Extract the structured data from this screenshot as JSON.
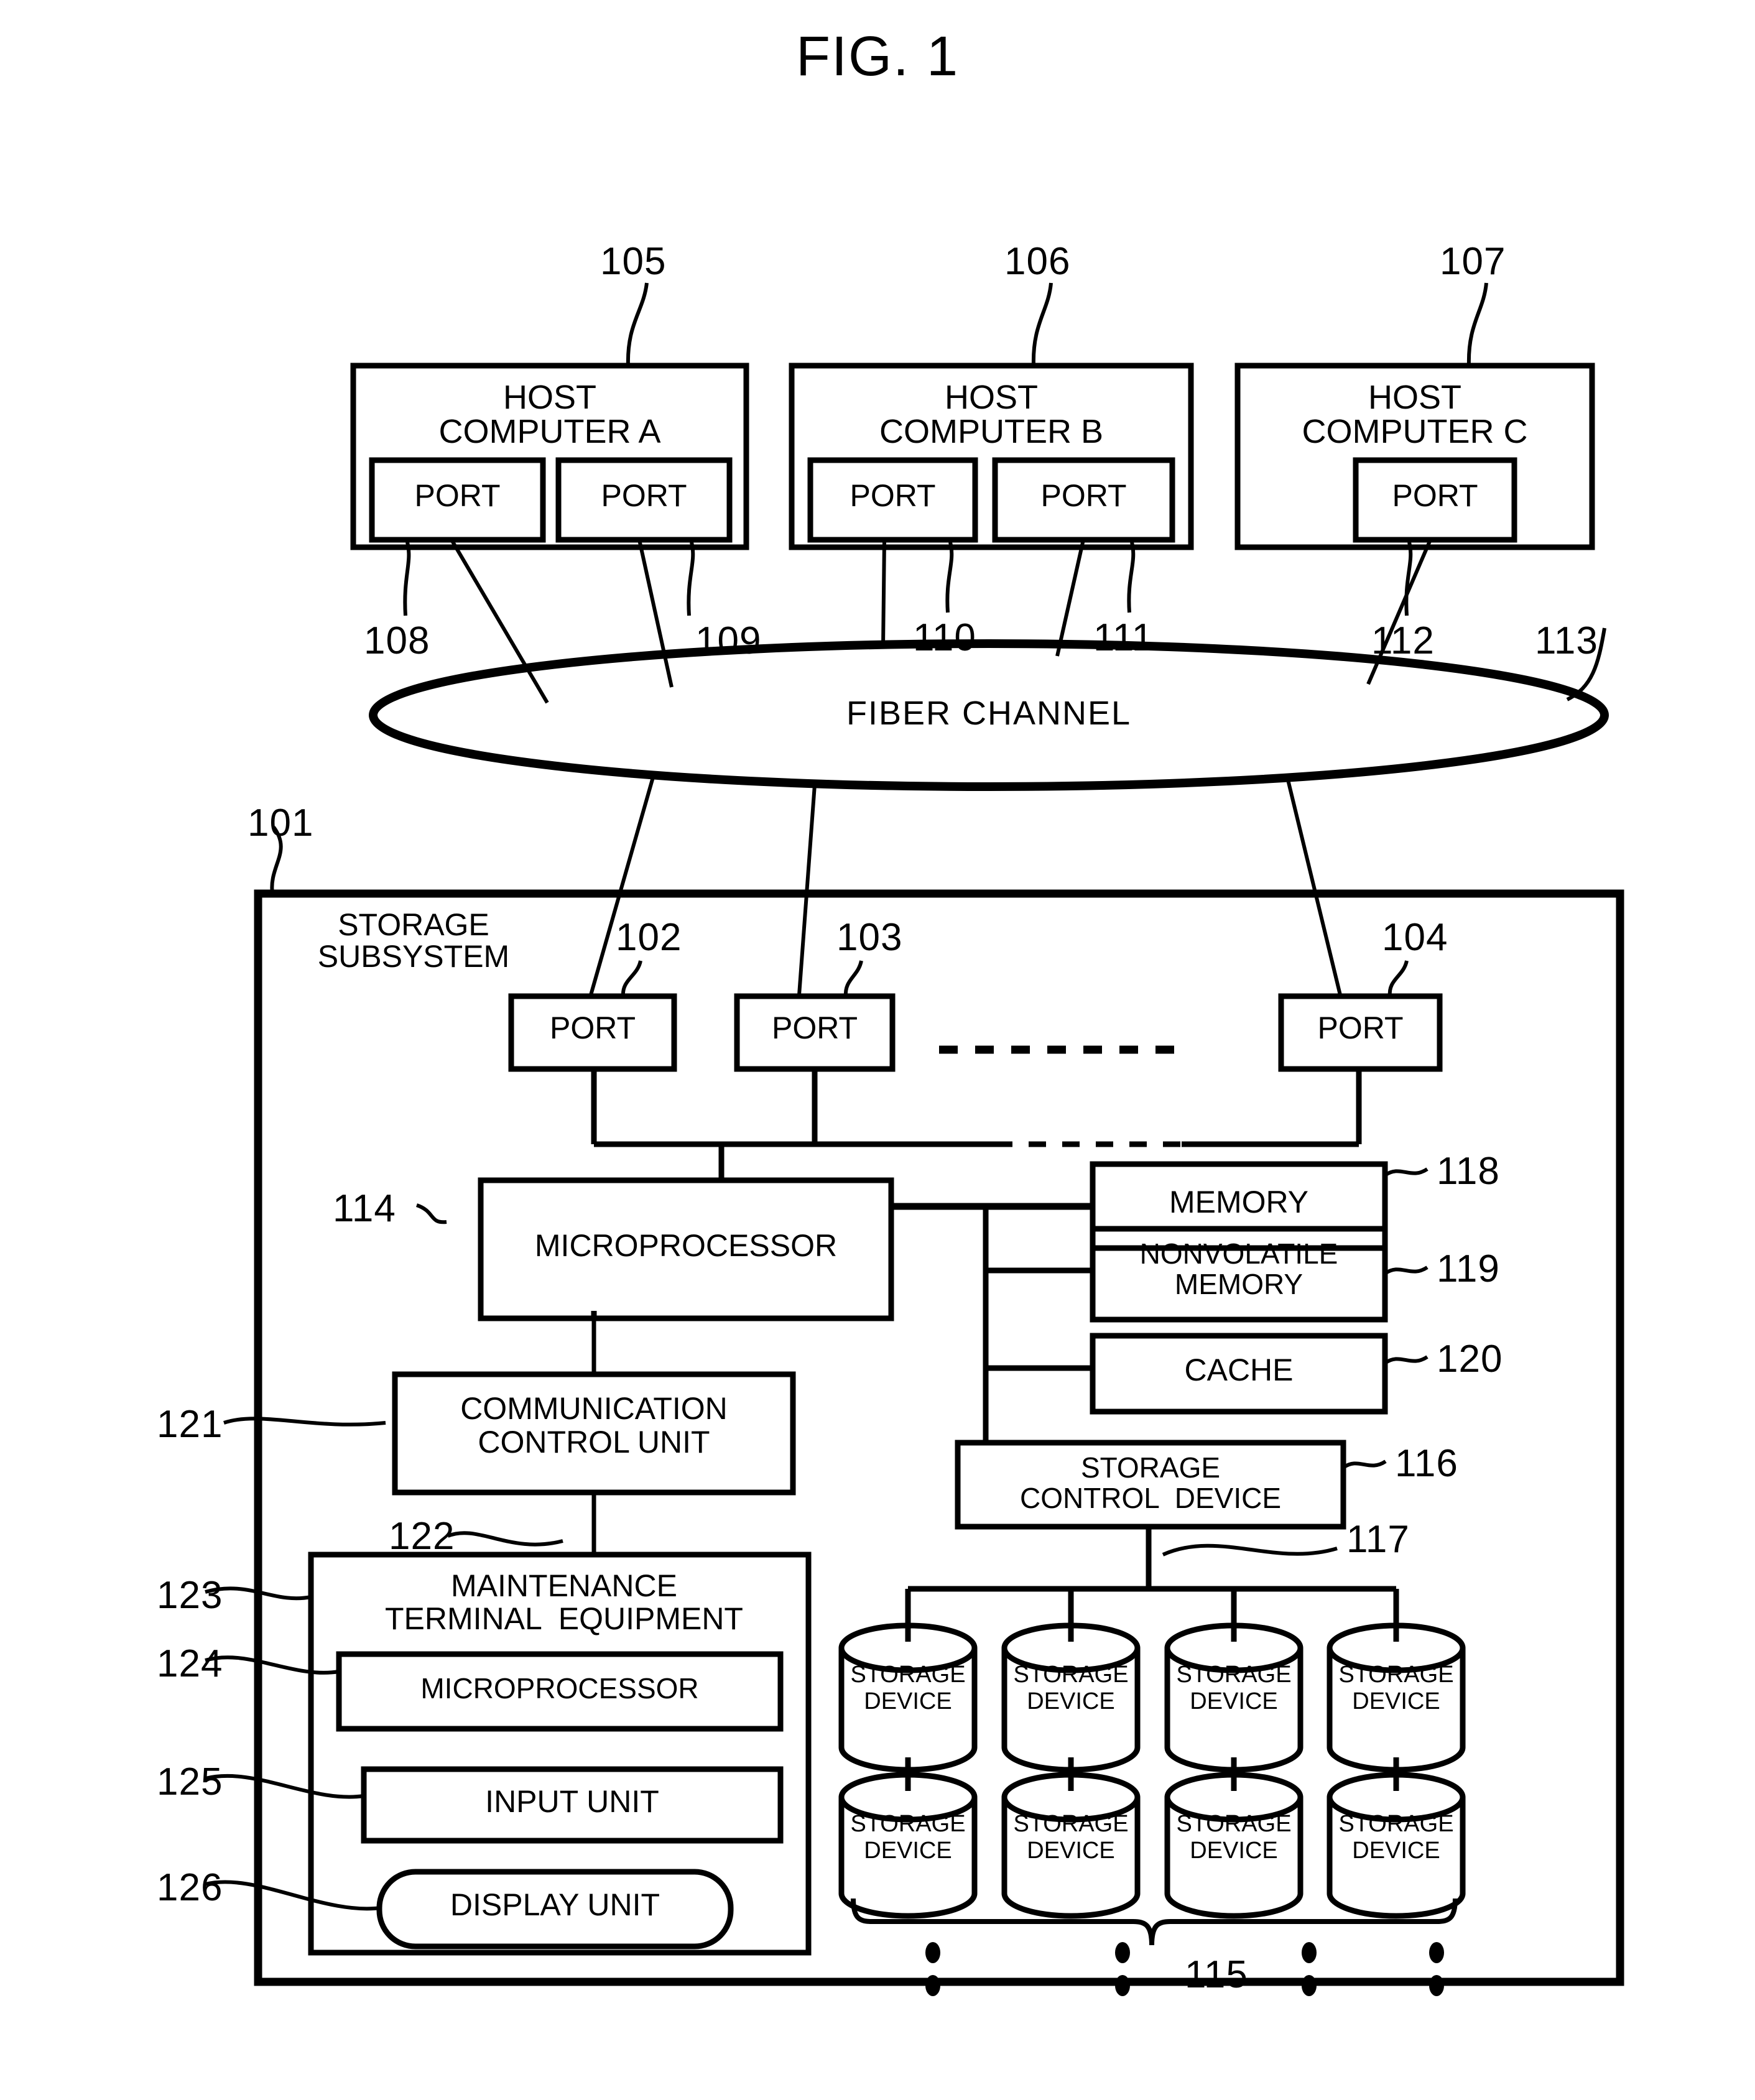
{
  "figure": {
    "title": "FIG. 1"
  },
  "hosts": [
    {
      "name": "host-computer-a",
      "line1": "HOST",
      "line2": "COMPUTER A",
      "ref": "105",
      "ports": [
        {
          "label": "PORT",
          "ref": "108"
        },
        {
          "label": "PORT",
          "ref": "109"
        }
      ]
    },
    {
      "name": "host-computer-b",
      "line1": "HOST",
      "line2": "COMPUTER B",
      "ref": "106",
      "ports": [
        {
          "label": "PORT",
          "ref": "110"
        },
        {
          "label": "PORT",
          "ref": "111"
        }
      ]
    },
    {
      "name": "host-computer-c",
      "line1": "HOST",
      "line2": "COMPUTER C",
      "ref": "107",
      "ports": [
        {
          "label": "PORT",
          "ref": "112"
        }
      ]
    }
  ],
  "network": {
    "label": "FIBER CHANNEL",
    "ref": "113"
  },
  "subsystem": {
    "line1": "STORAGE",
    "line2": "SUBSYSTEM",
    "ref": "101",
    "ports": [
      {
        "label": "PORT",
        "ref": "102"
      },
      {
        "label": "PORT",
        "ref": "103"
      },
      {
        "label": "PORT",
        "ref": "104"
      }
    ],
    "microprocessor": {
      "label": "MICROPROCESSOR",
      "ref": "114"
    },
    "memory": {
      "label": "MEMORY",
      "ref": "118"
    },
    "nonvolatile_memory": {
      "line1": "NONVOLATILE",
      "line2": "MEMORY",
      "ref": "119"
    },
    "cache": {
      "label": "CACHE",
      "ref": "120"
    },
    "storage_control_device": {
      "line1": "STORAGE",
      "line2": "CONTROL  DEVICE",
      "ref": "116"
    },
    "device_bus_ref": "117",
    "storage_devices_group_ref": "115",
    "storage_devices": [
      {
        "line1": "STORAGE",
        "line2": "DEVICE"
      },
      {
        "line1": "STORAGE",
        "line2": "DEVICE"
      },
      {
        "line1": "STORAGE",
        "line2": "DEVICE"
      },
      {
        "line1": "STORAGE",
        "line2": "DEVICE"
      },
      {
        "line1": "STORAGE",
        "line2": "DEVICE"
      },
      {
        "line1": "STORAGE",
        "line2": "DEVICE"
      },
      {
        "line1": "STORAGE",
        "line2": "DEVICE"
      },
      {
        "line1": "STORAGE",
        "line2": "DEVICE"
      }
    ],
    "communication_control_unit": {
      "line1": "COMMUNICATION",
      "line2": "CONTROL UNIT",
      "ref": "121"
    },
    "communication_link_ref": "122",
    "maintenance_terminal": {
      "line1": "MAINTENANCE",
      "line2": "TERMINAL  EQUIPMENT",
      "ref": "123",
      "microprocessor": {
        "label": "MICROPROCESSOR",
        "ref": "124"
      },
      "input_unit": {
        "label": "INPUT UNIT",
        "ref": "125"
      },
      "display_unit": {
        "label": "DISPLAY UNIT",
        "ref": "126"
      }
    }
  },
  "colors": {
    "ink": "#000000",
    "paper": "#ffffff"
  }
}
